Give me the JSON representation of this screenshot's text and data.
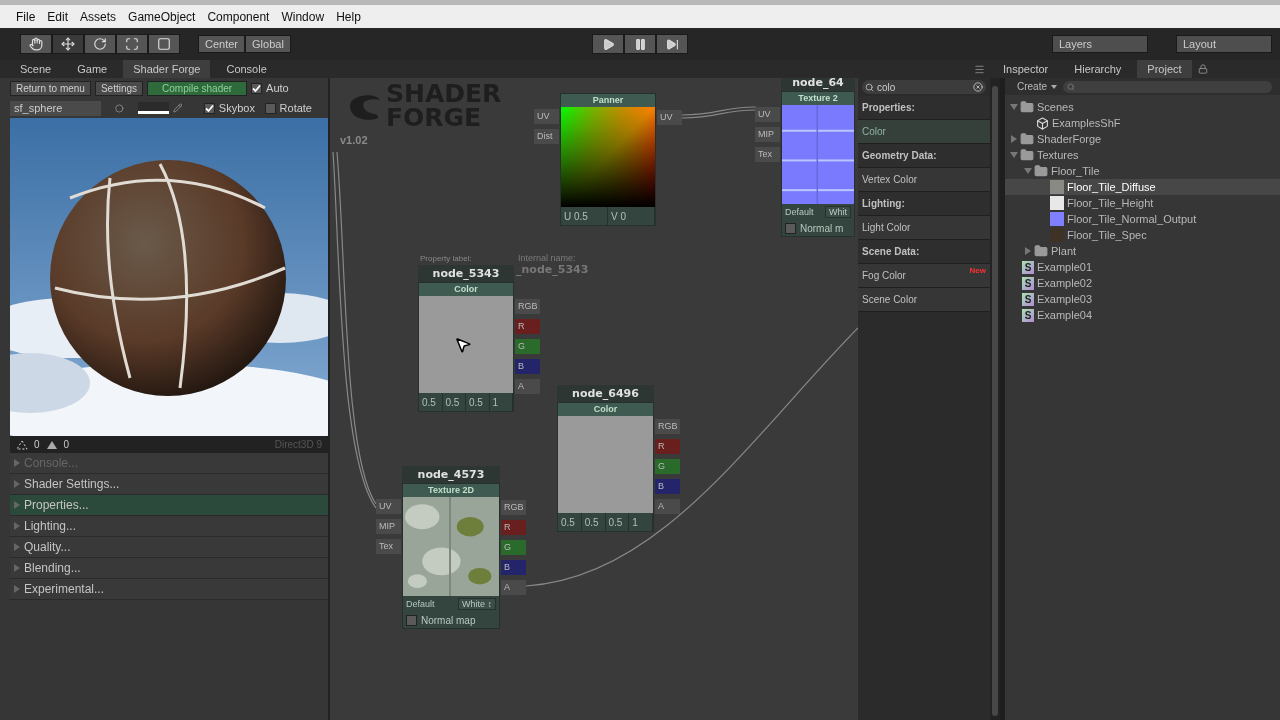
{
  "menu_bar": [
    "File",
    "Edit",
    "Assets",
    "GameObject",
    "Component",
    "Window",
    "Help"
  ],
  "toolbar": {
    "tools": [
      {
        "selected": false
      },
      {
        "selected": true
      },
      {
        "selected": false
      },
      {
        "selected": false
      },
      {
        "selected": false
      }
    ],
    "pivot": [
      "Center",
      "Global"
    ],
    "dropdowns": [
      "Layers",
      "Layout"
    ]
  },
  "tabs_left": [
    {
      "label": "Scene",
      "selected": false
    },
    {
      "label": "Game",
      "selected": false
    },
    {
      "label": "Shader Forge",
      "selected": true
    },
    {
      "label": "Console",
      "selected": false
    }
  ],
  "tabs_right": [
    {
      "label": "Inspector",
      "selected": false
    },
    {
      "label": "Hierarchy",
      "selected": false
    },
    {
      "label": "Project",
      "selected": true
    }
  ],
  "left_panel": {
    "buttons": [
      "Return to menu",
      "Settings"
    ],
    "compile": "Compile shader",
    "auto": {
      "label": "Auto",
      "checked": true
    },
    "mesh": "sf_sphere",
    "skybox": {
      "label": "Skybox",
      "checked": true
    },
    "rotate": {
      "label": "Rotate",
      "checked": false
    },
    "preview": {
      "kind": "picture"
    },
    "stats": [
      "0",
      "0"
    ],
    "renderer": "Direct3D 9",
    "sections": [
      {
        "label": "Console...",
        "disabled": true,
        "selected": false
      },
      {
        "label": "Shader Settings...",
        "disabled": false,
        "selected": false
      },
      {
        "label": "Properties...",
        "disabled": false,
        "selected": true
      },
      {
        "label": "Lighting...",
        "disabled": false,
        "selected": false
      },
      {
        "label": "Quality...",
        "disabled": false,
        "selected": false
      },
      {
        "label": "Blending...",
        "disabled": false,
        "selected": false
      },
      {
        "label": "Experimental...",
        "disabled": false,
        "selected": false
      }
    ]
  },
  "canvas": {
    "logo": [
      "SHADER",
      "FORGE"
    ],
    "version": "v1.02",
    "nodes": [
      {
        "kind": "panner",
        "type": "Panner",
        "inputs": [
          "UV",
          "Dist"
        ],
        "outputs": [
          {
            "label": "UV",
            "color": "#4a4a4a"
          }
        ],
        "values": [
          {
            "label": "U",
            "value": "0.5"
          },
          {
            "label": "V",
            "value": "0"
          }
        ]
      },
      {
        "kind": "texture",
        "title": "node_64",
        "type": "Texture 2",
        "inputs": [
          "UV",
          "MIP",
          "Tex"
        ],
        "default_label": "Default",
        "default_value": "Whit",
        "normal_map": {
          "label": "Normal m",
          "checked": false
        }
      },
      {
        "kind": "color",
        "title": "node_5343",
        "type": "Color",
        "property_label": "Property label:",
        "internal_label": "Internal name:",
        "internal_name": "_node_5343",
        "outputs": [
          {
            "label": "RGB",
            "color": "#4a4a4a"
          },
          {
            "label": "R",
            "color": "#6a1f1f"
          },
          {
            "label": "G",
            "color": "#2a6a2a"
          },
          {
            "label": "B",
            "color": "#24246a"
          },
          {
            "label": "A",
            "color": "#4a4a4a"
          }
        ],
        "values": [
          "0.5",
          "0.5",
          "0.5",
          "1"
        ]
      },
      {
        "kind": "color",
        "title": "node_6496",
        "type": "Color",
        "outputs": [
          {
            "label": "RGB",
            "color": "#4a4a4a"
          },
          {
            "label": "R",
            "color": "#6a1f1f"
          },
          {
            "label": "G",
            "color": "#2a6a2a"
          },
          {
            "label": "B",
            "color": "#24246a"
          },
          {
            "label": "A",
            "color": "#4a4a4a"
          }
        ],
        "values": [
          "0.5",
          "0.5",
          "0.5",
          "1"
        ]
      },
      {
        "kind": "texture",
        "title": "node_4573",
        "type": "Texture 2D",
        "inputs": [
          "UV",
          "MIP",
          "Tex"
        ],
        "outputs": [
          {
            "label": "RGB",
            "color": "#4a4a4a"
          },
          {
            "label": "R",
            "color": "#6a1f1f"
          },
          {
            "label": "G",
            "color": "#2a6a2a"
          },
          {
            "label": "B",
            "color": "#24246a"
          },
          {
            "label": "A",
            "color": "#4a4a4a"
          }
        ],
        "default_label": "Default",
        "default_value": "White ↕",
        "normal_map": {
          "label": "Normal map",
          "checked": false
        }
      }
    ]
  },
  "node_browser": {
    "search": "colo",
    "items": [
      {
        "kind": "heading",
        "label": "Properties:"
      },
      {
        "kind": "item",
        "label": "Color",
        "selected": true
      },
      {
        "kind": "heading",
        "label": "Geometry Data:"
      },
      {
        "kind": "item",
        "label": "Vertex Color",
        "selected": false
      },
      {
        "kind": "heading",
        "label": "Lighting:"
      },
      {
        "kind": "item",
        "label": "Light Color",
        "selected": false
      },
      {
        "kind": "heading",
        "label": "Scene Data:"
      },
      {
        "kind": "item",
        "label": "Fog Color",
        "selected": false,
        "badge": "New"
      },
      {
        "kind": "item",
        "label": "Scene Color",
        "selected": false
      }
    ]
  },
  "project": {
    "create": "Create",
    "tree": [
      {
        "label": "Scenes",
        "kind": "folder",
        "expanded": true,
        "selected": false,
        "children": [
          {
            "label": "ExamplesShF",
            "kind": "scene",
            "selected": false
          }
        ]
      },
      {
        "label": "ShaderForge",
        "kind": "folder",
        "expanded": false,
        "selected": false
      },
      {
        "label": "Textures",
        "kind": "folder",
        "expanded": true,
        "selected": false,
        "children": [
          {
            "label": "Floor_Tile",
            "kind": "folder",
            "expanded": true,
            "selected": false,
            "children": [
              {
                "label": "Floor_Tile_Diffuse",
                "kind": "texture",
                "color": "#8a8a84",
                "selected": true
              },
              {
                "label": "Floor_Tile_Height",
                "kind": "texture",
                "color": "#e8e8e8",
                "selected": false
              },
              {
                "label": "Floor_Tile_Normal_Output",
                "kind": "texture",
                "color": "#7f7fff",
                "selected": false
              },
              {
                "label": "Floor_Tile_Spec",
                "kind": "texture",
                "color": "#3e3226",
                "selected": false
              }
            ]
          },
          {
            "label": "Plant",
            "kind": "folder",
            "expanded": false,
            "selected": false
          }
        ]
      },
      {
        "label": "Example01",
        "kind": "shader",
        "badge": "S",
        "selected": false
      },
      {
        "label": "Example02",
        "kind": "shader",
        "badge": "S",
        "selected": false
      },
      {
        "label": "Example03",
        "kind": "shader",
        "badge": "S",
        "selected": false
      },
      {
        "label": "Example04",
        "kind": "shader",
        "badge": "S",
        "selected": false
      }
    ]
  }
}
